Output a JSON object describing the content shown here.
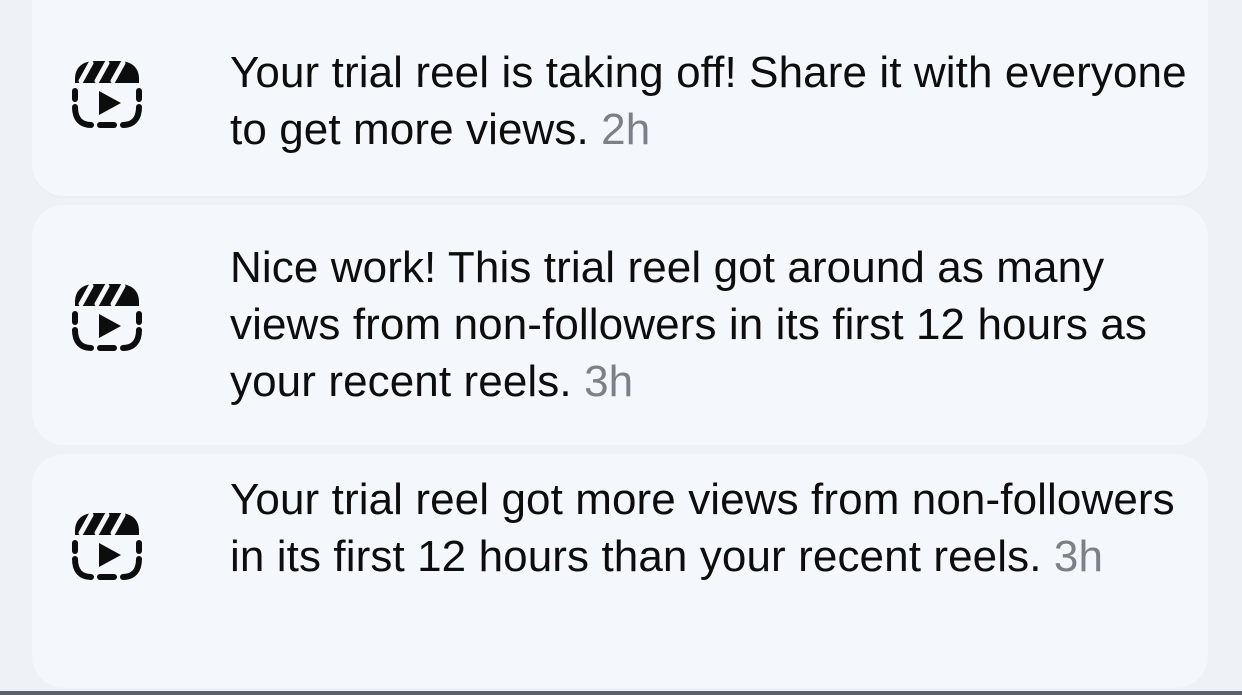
{
  "notifications": [
    {
      "icon": "reels-icon",
      "message": "Your trial reel is taking off! Share it with everyone to get more views.",
      "time": "2h"
    },
    {
      "icon": "reels-icon",
      "message": "Nice work! This trial reel got around as many views from non-followers in its first 12 hours as your recent reels.",
      "time": "3h"
    },
    {
      "icon": "reels-icon",
      "message": "Your trial reel got more views from non-followers in its first 12 hours than your recent reels.",
      "time": "3h"
    }
  ],
  "colors": {
    "background": "#eef1f5",
    "card": "#f4f7fb",
    "text": "#0d0d0d",
    "timestamp": "#7c8189"
  }
}
